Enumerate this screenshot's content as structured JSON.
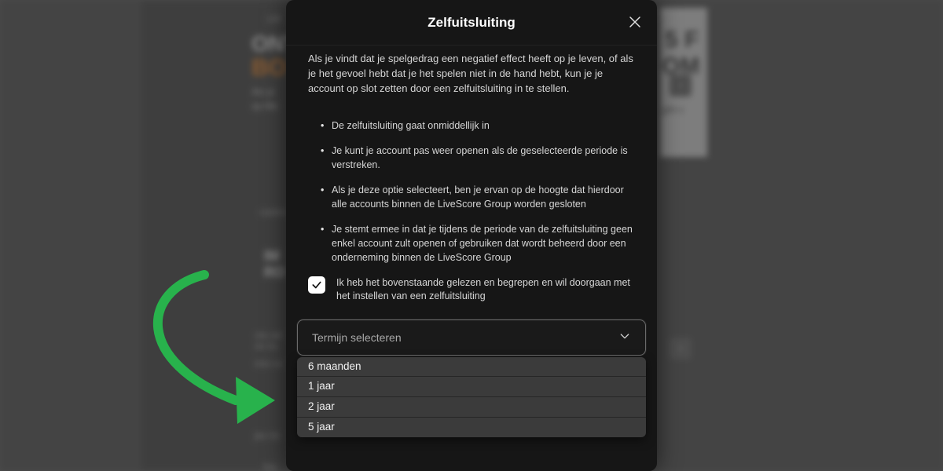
{
  "modal": {
    "title": "Zelfuitsluiting",
    "intro": "Als je vindt dat je spelgedrag een negatief effect heeft op je leven, of als je het gevoel hebt dat je het spelen niet in de hand hebt, kun je je account op slot zetten door een zelfuitsluiting in te stellen.",
    "bullets": [
      "De zelfuitsluiting gaat onmiddellijk in",
      "Je kunt je account pas weer openen als de geselecteerde periode is verstreken.",
      "Als je deze optie selecteert, ben je ervan op de hoogte dat hierdoor alle accounts binnen de LiveScore Group worden gesloten",
      "Je stemt ermee in dat je tijdens de periode van de zelfuitsluiting geen enkel account zult openen of gebruiken dat wordt beheerd door een onderneming binnen de LiveScore Group"
    ],
    "consent": "Ik heb het bovenstaande gelezen en begrepen en wil doorgaan met het instellen van een zelfuitsluiting",
    "consent_checked": true,
    "select": {
      "placeholder": "Termijn selecteren",
      "options": [
        "6 maanden",
        "1 jaar",
        "2 jaar",
        "5 jaar"
      ]
    }
  },
  "bg": {
    "nav1": "LIV",
    "h1a": "ONT",
    "h1b": "BO",
    "p1": "Als je",
    "p2": "op Me",
    "tag": "casino",
    "card": "IM\nRO",
    "t1": "cks wir",
    "t2": "rie Irv",
    "t3": "icks vs",
    "t4": "jke Int",
    "t5": "Sta",
    "r1": "5 F",
    "r2": "OM",
    "r3": "ght v"
  },
  "colors": {
    "arrow": "#28b24c"
  }
}
